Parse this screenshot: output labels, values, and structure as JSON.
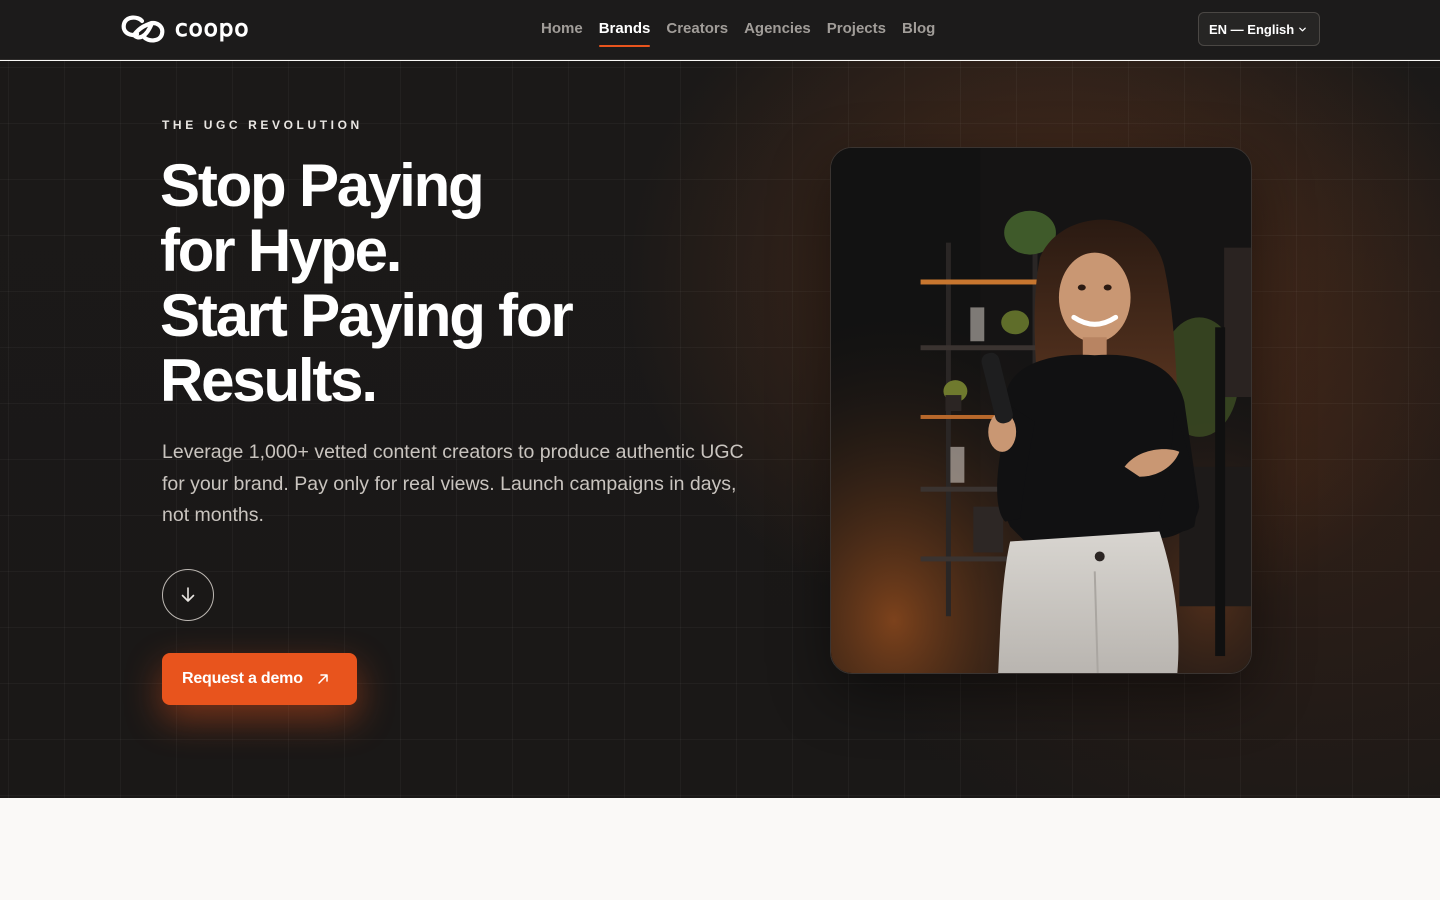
{
  "brand": {
    "name": "coopo"
  },
  "nav": {
    "items": [
      {
        "label": "Home",
        "active": false
      },
      {
        "label": "Brands",
        "active": true
      },
      {
        "label": "Creators",
        "active": false
      },
      {
        "label": "Agencies",
        "active": false
      },
      {
        "label": "Projects",
        "active": false
      },
      {
        "label": "Blog",
        "active": false
      }
    ]
  },
  "language": {
    "label": "EN — English"
  },
  "hero": {
    "eyebrow": "THE UGC REVOLUTION",
    "headline": [
      "Stop Paying",
      "for Hype.",
      "Start Paying for",
      "Results."
    ],
    "lede": "Leverage 1,000+ vetted content creators to produce authentic UGC for your brand. Pay only for real views. Launch campaigns in days, not months.",
    "cta_label": "Request a demo"
  },
  "icons": {
    "scroll": "arrow-down-icon",
    "cta": "arrow-up-right-icon",
    "language": "chevron-down-icon"
  },
  "colors": {
    "accent": "#e8541d",
    "hero_bg": "#1b1918",
    "header_bg": "#1c1b1b",
    "page_bg": "#faf9f7"
  }
}
